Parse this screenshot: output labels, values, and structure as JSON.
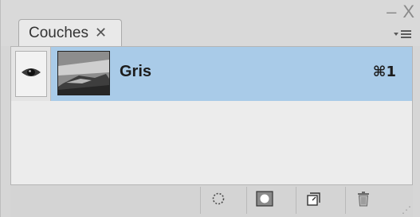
{
  "panel": {
    "tab_label": "Couches",
    "tab_close": "✕",
    "window_controls": [
      "–",
      "X"
    ],
    "menu_icon": "panel-menu-icon"
  },
  "channels": [
    {
      "name": "Gris",
      "shortcut": "⌘1",
      "visible": true,
      "selected": true
    }
  ],
  "footer_buttons": [
    {
      "icon": "load-channel-as-selection-icon"
    },
    {
      "icon": "save-selection-as-channel-icon"
    },
    {
      "icon": "new-channel-icon"
    },
    {
      "icon": "trash-icon"
    }
  ],
  "colors": {
    "selection": "#a9cbe8",
    "panel_bg": "#d6d6d6",
    "content_bg": "#ececec"
  }
}
